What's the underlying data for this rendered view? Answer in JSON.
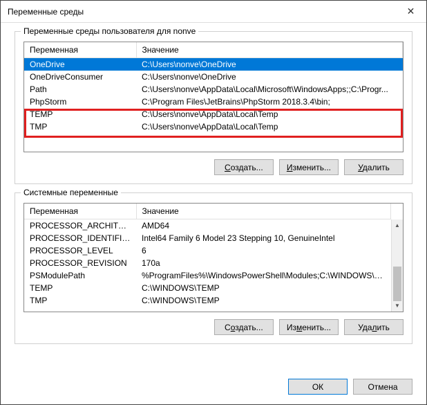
{
  "window": {
    "title": "Переменные среды",
    "close_icon": "✕"
  },
  "user_group": {
    "label": "Переменные среды пользователя для nonve",
    "columns": {
      "var": "Переменная",
      "val": "Значение"
    },
    "rows": [
      {
        "var": "OneDrive",
        "val": "C:\\Users\\nonve\\OneDrive"
      },
      {
        "var": "OneDriveConsumer",
        "val": "C:\\Users\\nonve\\OneDrive"
      },
      {
        "var": "Path",
        "val": "C:\\Users\\nonve\\AppData\\Local\\Microsoft\\WindowsApps;;C:\\Progr..."
      },
      {
        "var": "PhpStorm",
        "val": "C:\\Program Files\\JetBrains\\PhpStorm 2018.3.4\\bin;"
      },
      {
        "var": "TEMP",
        "val": "C:\\Users\\nonve\\AppData\\Local\\Temp"
      },
      {
        "var": "TMP",
        "val": "C:\\Users\\nonve\\AppData\\Local\\Temp"
      }
    ],
    "selected_index": 0,
    "highlighted_range": [
      4,
      5
    ]
  },
  "system_group": {
    "label": "Системные переменные",
    "columns": {
      "var": "Переменная",
      "val": "Значение"
    },
    "rows": [
      {
        "var": "PROCESSOR_ARCHITECTURE",
        "val": "AMD64"
      },
      {
        "var": "PROCESSOR_IDENTIFIER",
        "val": "Intel64 Family 6 Model 23 Stepping 10, GenuineIntel"
      },
      {
        "var": "PROCESSOR_LEVEL",
        "val": "6"
      },
      {
        "var": "PROCESSOR_REVISION",
        "val": "170a"
      },
      {
        "var": "PSModulePath",
        "val": "%ProgramFiles%\\WindowsPowerShell\\Modules;C:\\WINDOWS\\syst..."
      },
      {
        "var": "TEMP",
        "val": "C:\\WINDOWS\\TEMP"
      },
      {
        "var": "TMP",
        "val": "C:\\WINDOWS\\TEMP"
      }
    ]
  },
  "buttons": {
    "create": "Создать...",
    "edit": "Изменить...",
    "delete": "Удалить",
    "ok": "ОК",
    "cancel": "Отмена"
  }
}
